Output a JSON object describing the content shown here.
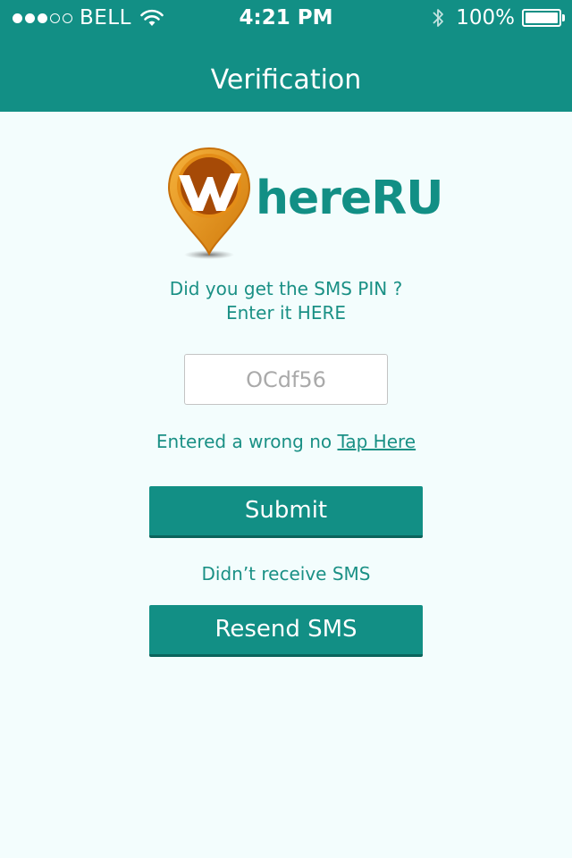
{
  "status_bar": {
    "carrier": "BELL",
    "time": "4:21 PM",
    "battery": "100%",
    "signal_bars_filled": 3,
    "signal_bars_total": 5,
    "battery_level": 1.0
  },
  "header": {
    "title": "Verification",
    "color": "#128f85"
  },
  "logo": {
    "text": "hereRU",
    "pin_color": "#e08a14",
    "text_color": "#128f85"
  },
  "prompt": {
    "line1": "Did you get the SMS PIN ?",
    "line2": "Enter it HERE"
  },
  "pin_input": {
    "placeholder": "OCdf56",
    "value": ""
  },
  "wrong_number": {
    "text": "Entered a wrong no ",
    "link": "Tap Here"
  },
  "submit_button": {
    "label": "Submit"
  },
  "didnt_receive": {
    "text": "Didn’t receive SMS"
  },
  "resend_button": {
    "label": "Resend SMS"
  }
}
